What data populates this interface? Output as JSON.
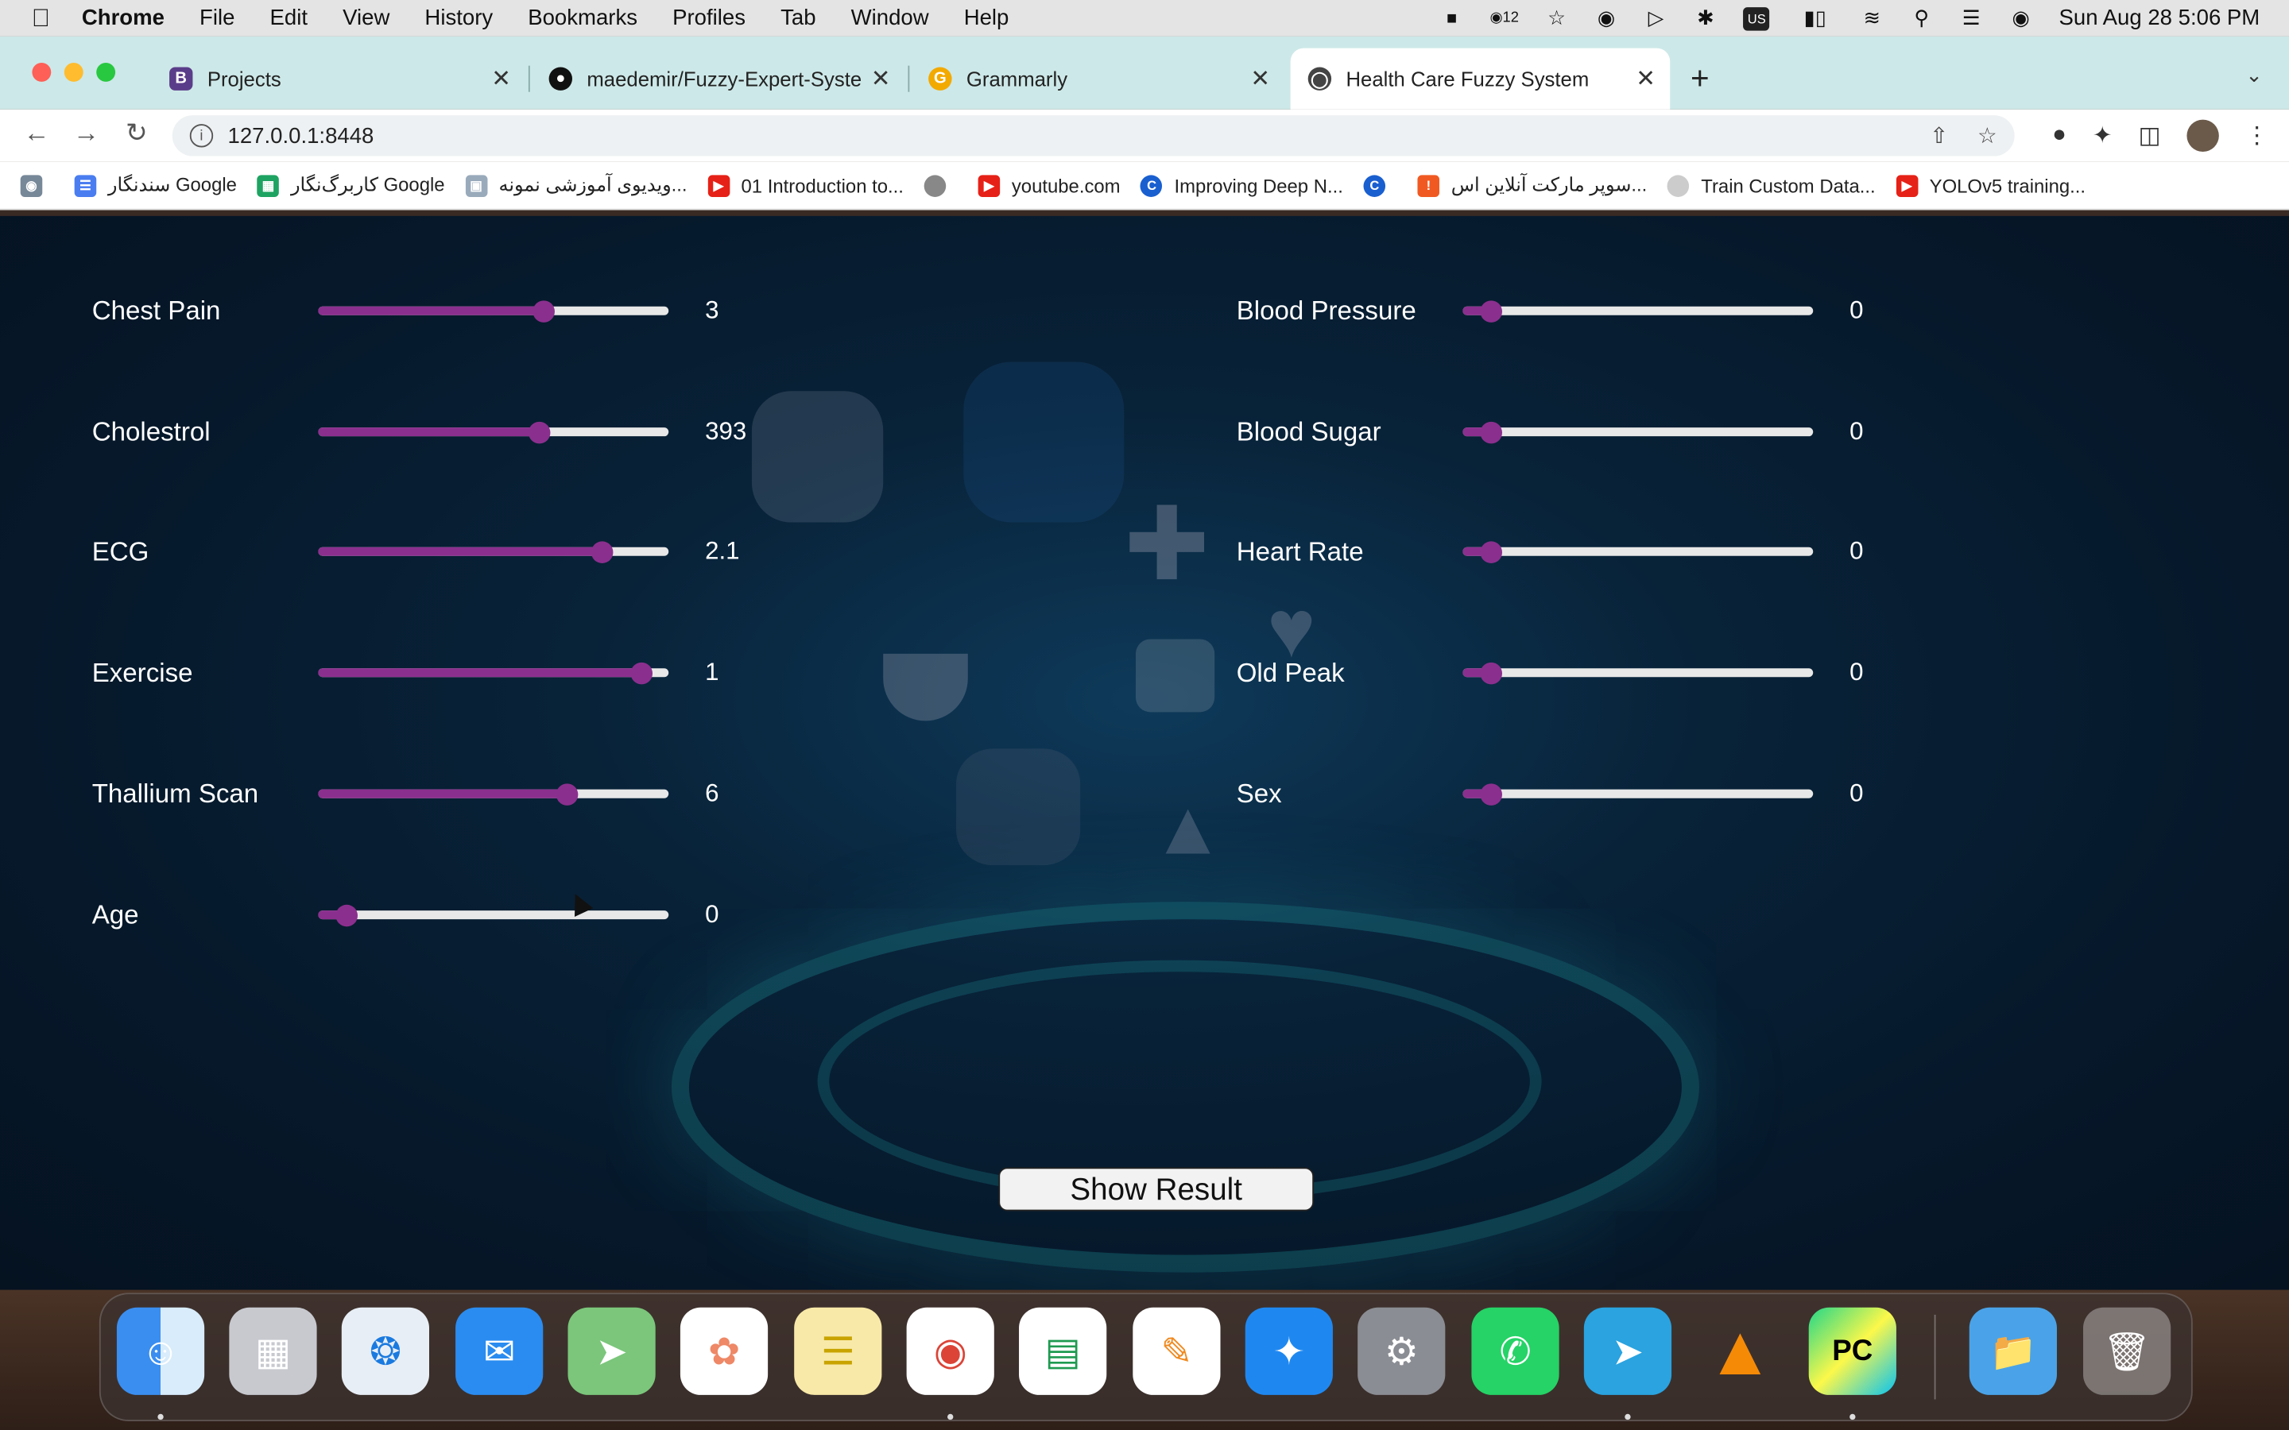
{
  "menubar": {
    "app_name": "Chrome",
    "menus": [
      "File",
      "Edit",
      "View",
      "History",
      "Bookmarks",
      "Profiles",
      "Tab",
      "Window",
      "Help"
    ],
    "clock": "Sun Aug 28  5:06 PM",
    "input_source": "US",
    "badge_count": "12"
  },
  "tabs": [
    {
      "title": "Projects",
      "favicon": "B"
    },
    {
      "title": "maedemir/Fuzzy-Expert-Syste",
      "favicon": "github-icon"
    },
    {
      "title": "Grammarly",
      "favicon": "G"
    },
    {
      "title": "Health Care Fuzzy System",
      "favicon": "globe-icon"
    }
  ],
  "address": "127.0.0.1:8448",
  "bookmarks": [
    "سندنگار Google",
    "کاربرگ‌نگار Google",
    "ویدیوی آموزشی نمونه...",
    "01 Introduction to...",
    "youtube.com",
    "Improving Deep N...",
    "سوپر مارکت آنلاین اس...",
    "Train Custom Data...",
    "YOLOv5 training..."
  ],
  "form": {
    "left": [
      {
        "label": "Chest Pain",
        "value": "3",
        "level": 0.64
      },
      {
        "label": "Cholestrol",
        "value": "393",
        "level": 0.63
      },
      {
        "label": "ECG",
        "value": "2.1",
        "level": 0.81
      },
      {
        "label": "Exercise",
        "value": "1",
        "level": 0.92
      },
      {
        "label": "Thallium Scan",
        "value": "6",
        "level": 0.71
      },
      {
        "label": "Age",
        "value": "0",
        "level": 0.08
      }
    ],
    "right": [
      {
        "label": "Blood Pressure",
        "value": "0",
        "level": 0.08
      },
      {
        "label": "Blood Sugar",
        "value": "0",
        "level": 0.08
      },
      {
        "label": "Heart Rate",
        "value": "0",
        "level": 0.08
      },
      {
        "label": "Old Peak",
        "value": "0",
        "level": 0.08
      },
      {
        "label": "Sex",
        "value": "0",
        "level": 0.08
      }
    ],
    "submit_label": "Show Result"
  },
  "colors": {
    "slider_fill": "#8b2f8e",
    "slider_track": "#e8e8e8",
    "tabbar": "#cde8e8"
  },
  "dock": [
    "Finder",
    "Launchpad",
    "Safari",
    "Mail",
    "Maps",
    "Photos",
    "Notes",
    "Chrome",
    "Numbers",
    "Pages",
    "App Store",
    "System Preferences",
    "WhatsApp",
    "Telegram",
    "VLC",
    "PyCharm",
    "Folder",
    "Trash"
  ]
}
